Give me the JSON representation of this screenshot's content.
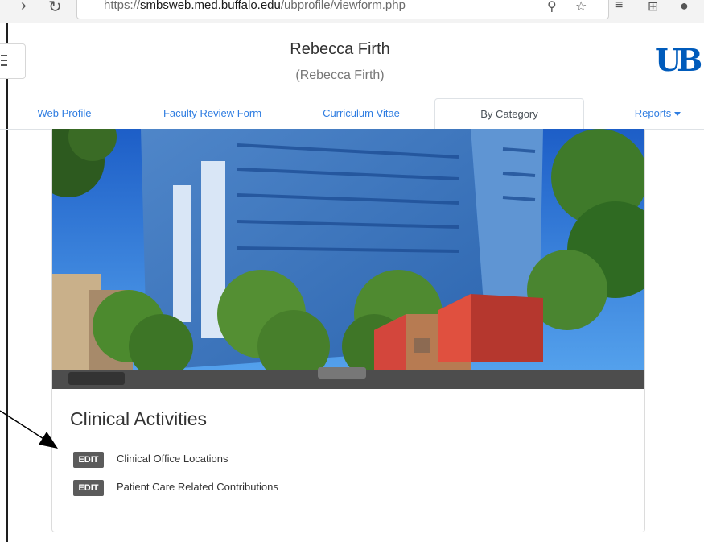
{
  "browser": {
    "url_scheme": "https://",
    "url_host": "smbsweb.med.buffalo.edu",
    "url_path": "/ubprofile/viewform.php"
  },
  "header": {
    "name": "Rebecca Firth",
    "subname": "(Rebecca Firth)",
    "logo": "UB",
    "menu_icon": "hamburger-icon"
  },
  "tabs": [
    {
      "label": "Web Profile",
      "active": false
    },
    {
      "label": "Faculty Review Form",
      "active": false
    },
    {
      "label": "Curriculum Vitae",
      "active": false
    },
    {
      "label": "By Category",
      "active": true
    },
    {
      "label": "Reports",
      "active": false,
      "has_dropdown": true
    }
  ],
  "section": {
    "title": "Clinical Activities",
    "items": [
      {
        "button": "EDIT",
        "label": "Clinical Office Locations"
      },
      {
        "button": "EDIT",
        "label": "Patient Care Related Contributions"
      }
    ]
  },
  "colors": {
    "link": "#2f7de1",
    "ub_blue": "#005bbb",
    "edit_button": "#5b5b5b"
  }
}
